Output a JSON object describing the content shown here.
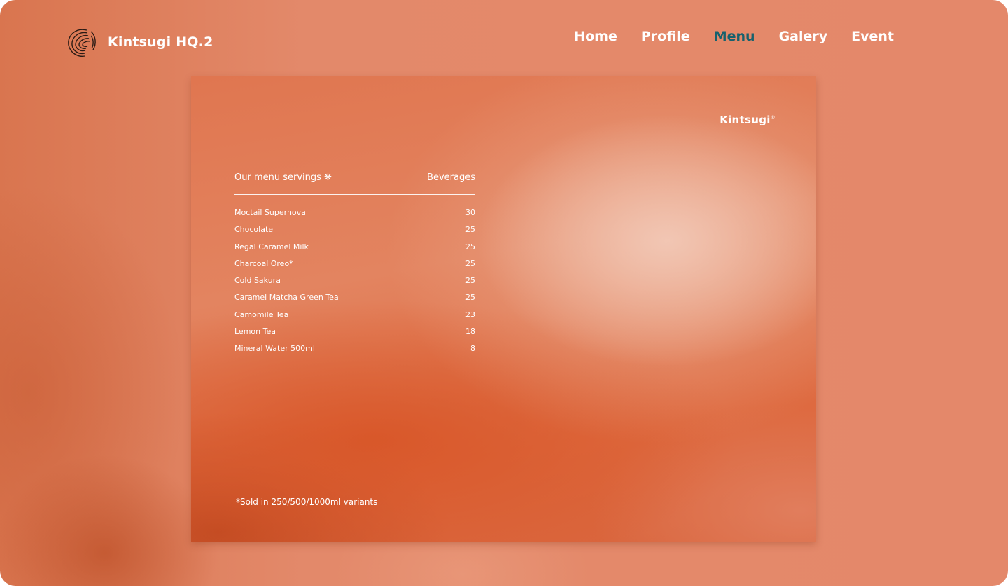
{
  "brand": {
    "name": "Kintsugi HQ.2",
    "logo_icon": "concentric-rings-icon"
  },
  "nav": {
    "items": [
      "Home",
      "Profile",
      "Menu",
      "Galery",
      "Event"
    ],
    "active": "Menu",
    "active_color": "#17616d"
  },
  "card": {
    "logo_text": "Kintsugi",
    "logo_mark": "®",
    "heading_left": "Our menu servings ❋",
    "heading_right": "Beverages",
    "items": [
      {
        "name": "Moctail Supernova",
        "price": "30"
      },
      {
        "name": "Chocolate",
        "price": "25"
      },
      {
        "name": "Regal Caramel Milk",
        "price": "25"
      },
      {
        "name": "Charcoal Oreo*",
        "price": "25"
      },
      {
        "name": "Cold Sakura",
        "price": "25"
      },
      {
        "name": "Caramel Matcha Green Tea",
        "price": "25"
      },
      {
        "name": "Camomile Tea",
        "price": "23"
      },
      {
        "name": "Lemon Tea",
        "price": "18"
      },
      {
        "name": "Mineral Water 500ml",
        "price": "8"
      }
    ],
    "footnote": "*Sold in 250/500/1000ml variants"
  },
  "colors": {
    "background": "#e3896a",
    "text": "#ffffff"
  }
}
